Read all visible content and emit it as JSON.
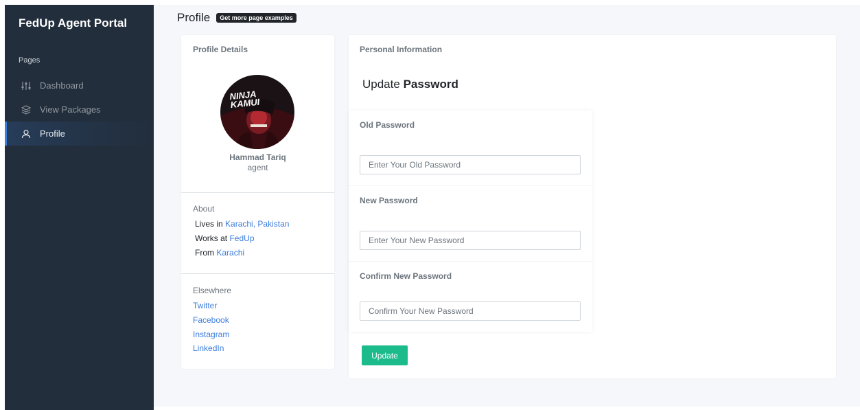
{
  "sidebar": {
    "brand": "FedUp Agent Portal",
    "section_label": "Pages",
    "items": [
      {
        "label": "Dashboard",
        "icon": "sliders-icon"
      },
      {
        "label": "View Packages",
        "icon": "layers-icon"
      },
      {
        "label": "Profile",
        "icon": "user-icon",
        "active": true
      }
    ]
  },
  "header": {
    "title": "Profile",
    "badge": "Get more page examples"
  },
  "profile": {
    "card_title": "Profile Details",
    "avatar_text": "NINJA KAMUI",
    "name": "Hammad Tariq",
    "role": "agent",
    "about": {
      "title": "About",
      "lives_prefix": "Lives in",
      "lives_value": "Karachi, Pakistan",
      "works_prefix": "Works at",
      "works_value": "FedUp",
      "from_prefix": "From",
      "from_value": "Karachi"
    },
    "elsewhere": {
      "title": "Elsewhere",
      "links": [
        "Twitter",
        "Facebook",
        "Instagram",
        "LinkedIn"
      ]
    }
  },
  "password": {
    "card_title": "Personal Information",
    "heading_prefix": "Update",
    "heading_bold": "Password",
    "old_label": "Old Password",
    "old_placeholder": "Enter Your Old Password",
    "new_label": "New Password",
    "new_placeholder": "Enter Your New Password",
    "confirm_label": "Confirm New Password",
    "confirm_placeholder": "Confirm Your New Password",
    "button": "Update"
  },
  "colors": {
    "sidebar_bg": "#222e3c",
    "accent": "#3b7ddd",
    "success": "#1cbb8c",
    "page_bg": "#f5f7fb"
  }
}
